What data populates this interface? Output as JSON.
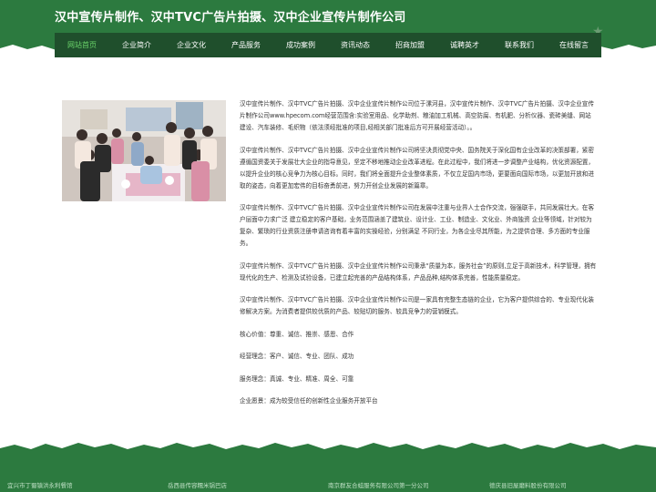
{
  "header": {
    "title": "汉中宣传片制作、汉中TVC广告片拍摄、汉中企业宣传片制作公司",
    "decor_icon": "star-icon"
  },
  "nav": {
    "items": [
      {
        "label": "网站首页",
        "active": true
      },
      {
        "label": "企业简介",
        "active": false
      },
      {
        "label": "企业文化",
        "active": false
      },
      {
        "label": "产品服务",
        "active": false
      },
      {
        "label": "成功案例",
        "active": false
      },
      {
        "label": "资讯动态",
        "active": false
      },
      {
        "label": "招商加盟",
        "active": false
      },
      {
        "label": "诚聘英才",
        "active": false
      },
      {
        "label": "联系我们",
        "active": false
      },
      {
        "label": "在线留言",
        "active": false
      }
    ]
  },
  "main": {
    "paragraphs": [
      "汉中宣传片制作、汉中TVC广告片拍摄、汉中企业宣传片制作公司位于漯河县，汉中宣传片制作、汉中TVC广告片拍摄、汉中企业宣传片制作公司www.hpecom.com经营范围含:实验室用品、化学助剂、粮油加工机械、高空防腐、有机肥、分析仪器、瓷砖美缝、网站建设、汽车装修、毛织物（依法须经批准的项目,经相关部门批准后方可开展经营活动）。。",
      "汉中宣传片制作、汉中TVC广告片拍摄、汉中企业宣传片制作公司将坚决贯彻党中央、国务院关于深化国有企业改革的决策部署，紧密遵循国资委关于发展壮大企业的指导意见，坚定不移地推动企业改革进程。在此过程中，我们将进一步调整产业结构，优化资源配置，以提升企业的核心竞争力为核心目标。同时，我们将全面提升企业整体素质，不仅立足国内市场，更要面向国际市场，以更加开放和进取的姿态，向着更加宏伟的目标奋勇前进，努力开创企业发展的新篇章。",
      "汉中宣传片制作、汉中TVC广告片拍摄、汉中企业宣传片制作公司在发展中注重与业界人士合作交流，强强联手，共同发展壮大。在客户层面中力求广泛 建立稳定的客户基础，业务范围涵盖了建筑业、设计业、工业、制造业、文化业、外商独资 企业等领域，针对较为复杂、繁琐的行业资质注册申请咨询有着丰富的实操经验，分别满足 不同行业，为各企业尽其所能，为之提供合理、多方面的专业服务。",
      "汉中宣传片制作、汉中TVC广告片拍摄、汉中企业宣传片制作公司秉承“质量为本，服务社会”的原则,立足于高新技术，科学管理，拥有现代化的生产、检测及试验设备，已建立起完善的产品结构体系，产品品种,结构体系完善，性能质量稳定。",
      "汉中宣传片制作、汉中TVC广告片拍摄、汉中企业宣传片制作公司是一家具有完整生态链的企业，它为客户提供综合的、专业现代化装修解决方案。为消费者提供较优质的产品、较贴切的服务、较具竞争力的营销模式。",
      "核心价值：尊重、诚信、推崇、感恩、合作",
      "经营理念：客户、诚信、专业、团队、成功",
      "服务理念：真诚、专业、精准、周全、可靠",
      "企业愿景：成为较受信任的创新性企业服务开放平台"
    ],
    "photo_alt": "group-photo"
  },
  "footer": {
    "links": [
      "宜兴市丁蜀镇洪永利餐馆",
      "岳西县传容糯米锅巴店",
      "南京群友合蛙服务有限公司第一分公司",
      "德庆县旧屋磨料股份有限公司"
    ]
  },
  "colors": {
    "header_green": "#2c7a3f",
    "nav_dark_green": "#1f4f2c",
    "nav_active": "#6ad36a"
  }
}
